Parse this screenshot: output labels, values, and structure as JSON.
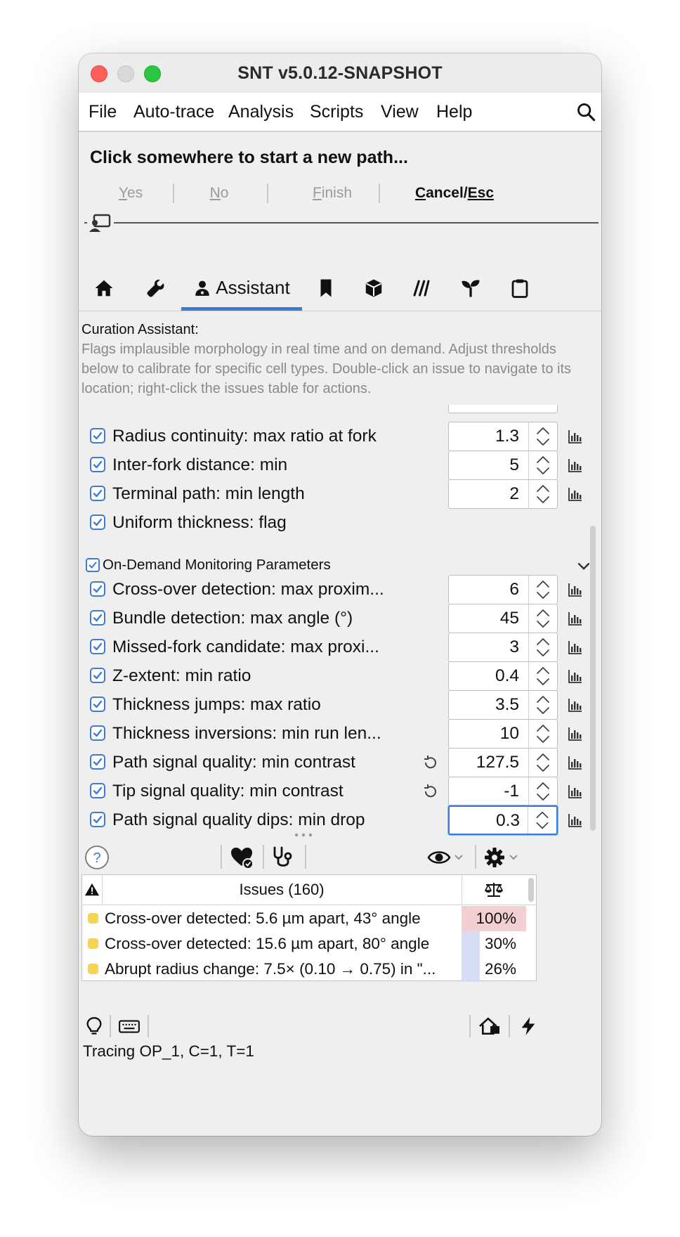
{
  "window": {
    "title": "SNT v5.0.12-SNAPSHOT"
  },
  "menu": {
    "items": [
      "File",
      "Auto-trace",
      "Analysis",
      "Scripts",
      "View",
      "Help"
    ]
  },
  "prompt": {
    "text": "Click somewhere to start a new path...",
    "buttons": [
      {
        "first": "Y",
        "rest": "es",
        "enabled": false
      },
      {
        "first": "N",
        "rest": "o",
        "enabled": false
      },
      {
        "first": "F",
        "rest": "inish",
        "enabled": false
      },
      {
        "first": "C",
        "rest": "ancel/",
        "tail": "Esc",
        "enabled": true
      }
    ]
  },
  "tabs": {
    "active_label": "Assistant",
    "icons": [
      "home-icon",
      "wrench-icon",
      "assistant-icon",
      "bookmark-icon",
      "cube-icon",
      "paths-icon",
      "sprout-icon",
      "clipboard-icon"
    ]
  },
  "curation": {
    "title": "Curation Assistant:",
    "description": "Flags implausible morphology in real time and on demand. Adjust thresholds below to calibrate for specific cell types. Double-click an issue to navigate to its location; right-click the issues table for actions."
  },
  "realtime_params": [
    {
      "label": "Radius continuity: max ratio at fork",
      "value": "1.3",
      "checked": true
    },
    {
      "label": "Inter-fork distance: min",
      "value": "5",
      "checked": true
    },
    {
      "label": "Terminal path: min length",
      "value": "2",
      "checked": true
    },
    {
      "label": "Uniform thickness: flag",
      "value": null,
      "checked": true
    }
  ],
  "ondemand_section": {
    "label": "On-Demand Monitoring Parameters",
    "checked": true
  },
  "ondemand_params": [
    {
      "label": "Cross-over detection: max proxim...",
      "value": "6",
      "checked": true,
      "reset": false
    },
    {
      "label": "Bundle detection: max angle (°)",
      "value": "45",
      "checked": true,
      "reset": false
    },
    {
      "label": "Missed-fork candidate: max proxi...",
      "value": "3",
      "checked": true,
      "reset": false
    },
    {
      "label": "Z-extent: min ratio",
      "value": "0.4",
      "checked": true,
      "reset": false
    },
    {
      "label": "Thickness jumps: max ratio",
      "value": "3.5",
      "checked": true,
      "reset": false
    },
    {
      "label": "Thickness inversions: min run len...",
      "value": "10",
      "checked": true,
      "reset": false
    },
    {
      "label": "Path signal quality: min contrast",
      "value": "127.5",
      "checked": true,
      "reset": true
    },
    {
      "label": "Tip signal quality: min contrast",
      "value": "-1",
      "checked": true,
      "reset": true
    },
    {
      "label": "Path signal quality dips: min drop",
      "value": "0.3",
      "checked": true,
      "reset": false,
      "focused": true
    }
  ],
  "issues": {
    "header": "Issues (160)",
    "rows": [
      {
        "text": "Cross-over detected: 5.6 µm apart, 43° angle",
        "pct": "100%",
        "level": 1.0,
        "bar_color": "#f2cfd0"
      },
      {
        "text": "Cross-over detected: 15.6 µm apart, 80° angle",
        "pct": "30%",
        "level": 0.3,
        "bar_color": "#d5ddf2"
      },
      {
        "text": "Abrupt radius change: 7.5× (0.10 → 0.75) in \"...",
        "pct": "26%",
        "level": 0.26,
        "bar_color": "#d5ddf2"
      }
    ]
  },
  "status": {
    "text": "Tracing OP_1, C=1, T=1"
  }
}
